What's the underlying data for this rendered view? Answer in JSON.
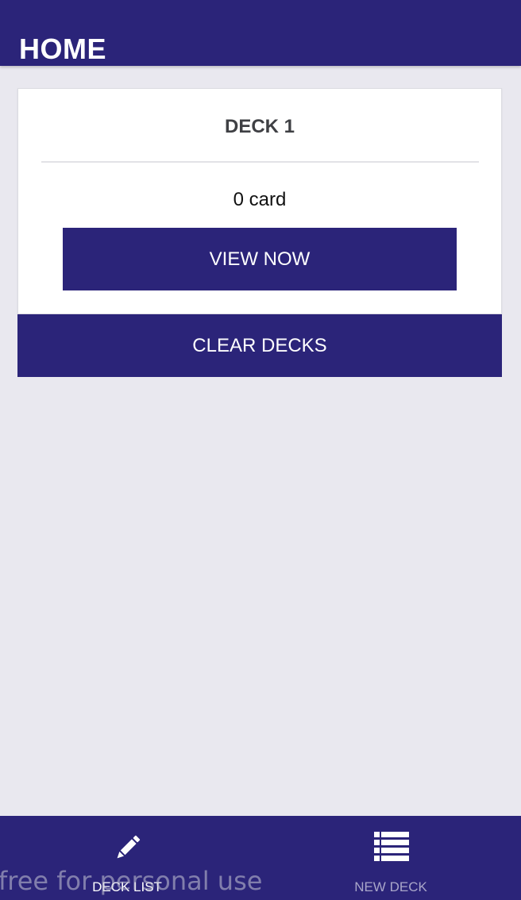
{
  "header": {
    "title": "HOME"
  },
  "decks": [
    {
      "title": "DECK 1",
      "count_text": "0 card",
      "view_label": "VIEW NOW"
    }
  ],
  "actions": {
    "clear_label": "CLEAR DECKS"
  },
  "tabbar": {
    "tabs": [
      {
        "label": "DECK LIST",
        "icon": "pencil-icon",
        "active": true
      },
      {
        "label": "NEW DECK",
        "icon": "list-icon",
        "active": false
      }
    ]
  },
  "watermark": {
    "text": "free for personal use"
  },
  "colors": {
    "primary": "#2b2479",
    "background": "#e9e8ef",
    "card": "#ffffff",
    "tab_inactive": "#a9a6c9"
  }
}
